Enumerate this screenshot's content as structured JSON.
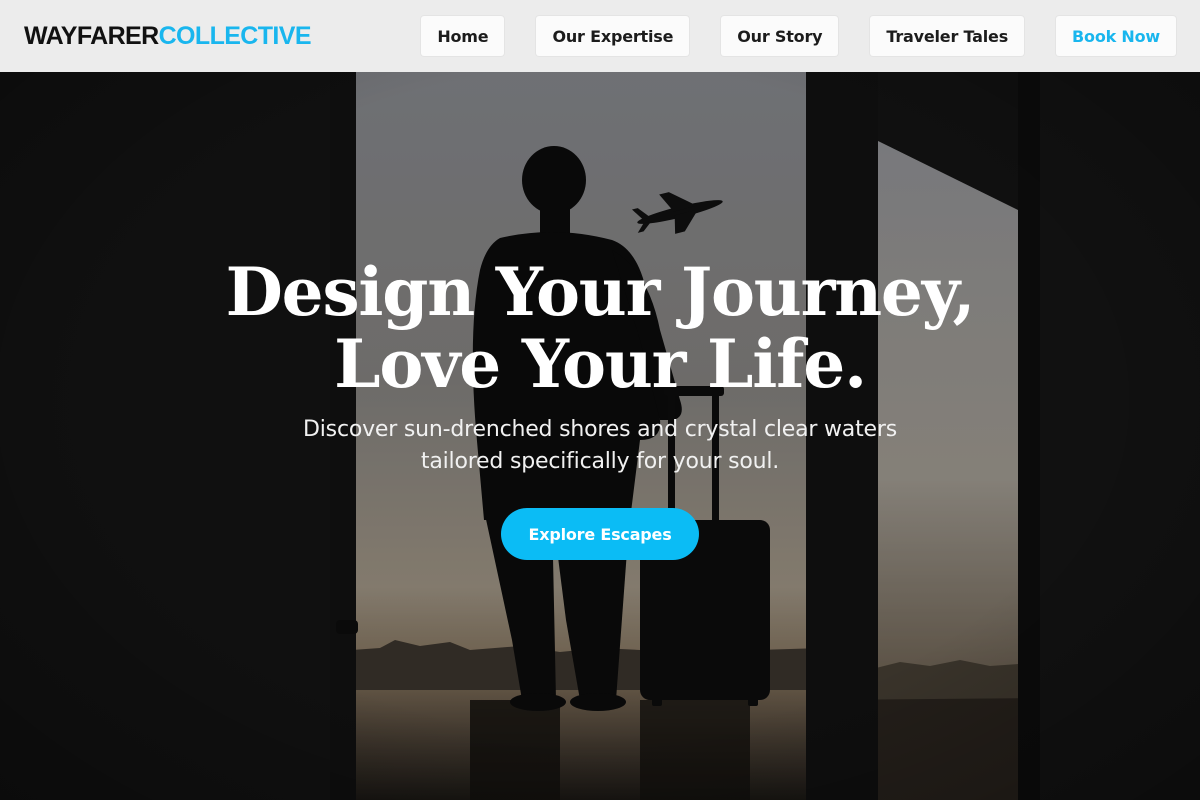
{
  "brand": {
    "name_part_1": "WAYFARER",
    "name_part_2": "COLLECTIVE",
    "accent_color": "#19b6ee"
  },
  "nav": {
    "items": [
      {
        "label": "Home"
      },
      {
        "label": "Our Expertise"
      },
      {
        "label": "Our Story"
      },
      {
        "label": "Traveler Tales"
      },
      {
        "label": "Book Now"
      }
    ]
  },
  "hero": {
    "headline_line_1": "Design Your Journey,",
    "headline_line_2": "Love Your Life.",
    "subtitle_line_1": "Discover sun-drenched shores and crystal clear waters",
    "subtitle_line_2": "tailored specifically for your soul.",
    "cta_label": "Explore Escapes",
    "cta_color": "#0bbcf5",
    "background_image": "silhouette-traveler-with-suitcase-at-airport-window"
  }
}
